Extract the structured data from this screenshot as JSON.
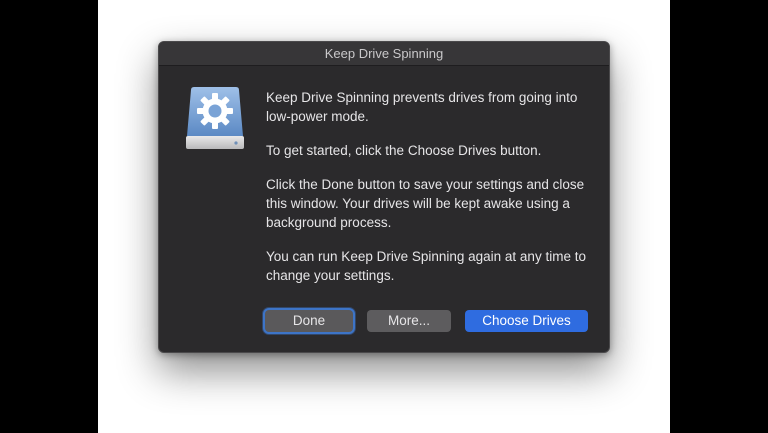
{
  "window": {
    "title": "Keep Drive Spinning"
  },
  "icon": {
    "name": "drive-gear-icon"
  },
  "message": {
    "paragraphs": [
      "Keep Drive Spinning prevents drives from going into low-power mode.",
      "To get started, click the Choose Drives button.",
      "Click the Done button to save your settings and close this window. Your drives will be kept awake using a background process.",
      "You can run Keep Drive Spinning again at any time to change your settings."
    ]
  },
  "buttons": {
    "done": "Done",
    "more": "More...",
    "choose_drives": "Choose Drives"
  },
  "colors": {
    "window_bg": "#2b2a2c",
    "accent": "#2f6ce0",
    "focus_ring": "#3d74c7"
  }
}
